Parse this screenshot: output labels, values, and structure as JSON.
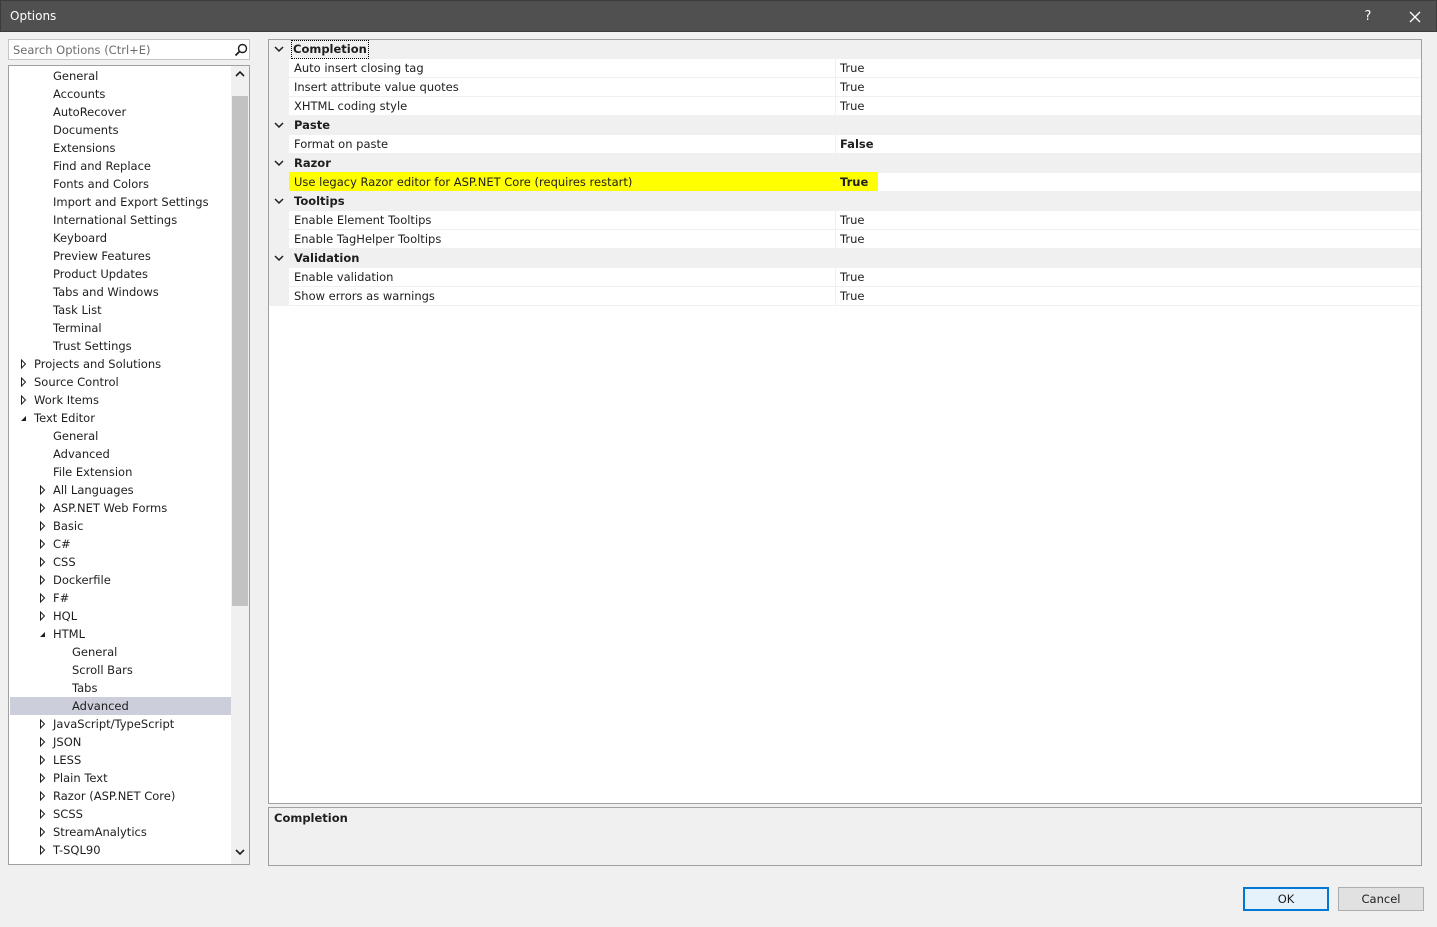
{
  "window": {
    "title": "Options",
    "help_label": "?"
  },
  "search": {
    "placeholder": "Search Options (Ctrl+E)",
    "value": ""
  },
  "tree": {
    "items": [
      {
        "label": "General",
        "level": 2,
        "arrow": "none"
      },
      {
        "label": "Accounts",
        "level": 2,
        "arrow": "none"
      },
      {
        "label": "AutoRecover",
        "level": 2,
        "arrow": "none"
      },
      {
        "label": "Documents",
        "level": 2,
        "arrow": "none"
      },
      {
        "label": "Extensions",
        "level": 2,
        "arrow": "none"
      },
      {
        "label": "Find and Replace",
        "level": 2,
        "arrow": "none"
      },
      {
        "label": "Fonts and Colors",
        "level": 2,
        "arrow": "none"
      },
      {
        "label": "Import and Export Settings",
        "level": 2,
        "arrow": "none"
      },
      {
        "label": "International Settings",
        "level": 2,
        "arrow": "none"
      },
      {
        "label": "Keyboard",
        "level": 2,
        "arrow": "none"
      },
      {
        "label": "Preview Features",
        "level": 2,
        "arrow": "none"
      },
      {
        "label": "Product Updates",
        "level": 2,
        "arrow": "none"
      },
      {
        "label": "Tabs and Windows",
        "level": 2,
        "arrow": "none"
      },
      {
        "label": "Task List",
        "level": 2,
        "arrow": "none"
      },
      {
        "label": "Terminal",
        "level": 2,
        "arrow": "none"
      },
      {
        "label": "Trust Settings",
        "level": 2,
        "arrow": "none"
      },
      {
        "label": "Projects and Solutions",
        "level": 1,
        "arrow": "collapsed"
      },
      {
        "label": "Source Control",
        "level": 1,
        "arrow": "collapsed"
      },
      {
        "label": "Work Items",
        "level": 1,
        "arrow": "collapsed"
      },
      {
        "label": "Text Editor",
        "level": 1,
        "arrow": "expanded"
      },
      {
        "label": "General",
        "level": 2,
        "arrow": "none"
      },
      {
        "label": "Advanced",
        "level": 2,
        "arrow": "none"
      },
      {
        "label": "File Extension",
        "level": 2,
        "arrow": "none"
      },
      {
        "label": "All Languages",
        "level": 2,
        "arrow": "collapsed"
      },
      {
        "label": "ASP.NET Web Forms",
        "level": 2,
        "arrow": "collapsed"
      },
      {
        "label": "Basic",
        "level": 2,
        "arrow": "collapsed"
      },
      {
        "label": "C#",
        "level": 2,
        "arrow": "collapsed"
      },
      {
        "label": "CSS",
        "level": 2,
        "arrow": "collapsed"
      },
      {
        "label": "Dockerfile",
        "level": 2,
        "arrow": "collapsed"
      },
      {
        "label": "F#",
        "level": 2,
        "arrow": "collapsed"
      },
      {
        "label": "HQL",
        "level": 2,
        "arrow": "collapsed"
      },
      {
        "label": "HTML",
        "level": 2,
        "arrow": "expanded"
      },
      {
        "label": "General",
        "level": 3,
        "arrow": "none"
      },
      {
        "label": "Scroll Bars",
        "level": 3,
        "arrow": "none"
      },
      {
        "label": "Tabs",
        "level": 3,
        "arrow": "none"
      },
      {
        "label": "Advanced",
        "level": 3,
        "arrow": "none",
        "selected": true
      },
      {
        "label": "JavaScript/TypeScript",
        "level": 2,
        "arrow": "collapsed"
      },
      {
        "label": "JSON",
        "level": 2,
        "arrow": "collapsed"
      },
      {
        "label": "LESS",
        "level": 2,
        "arrow": "collapsed"
      },
      {
        "label": "Plain Text",
        "level": 2,
        "arrow": "collapsed"
      },
      {
        "label": "Razor (ASP.NET Core)",
        "level": 2,
        "arrow": "collapsed"
      },
      {
        "label": "SCSS",
        "level": 2,
        "arrow": "collapsed"
      },
      {
        "label": "StreamAnalytics",
        "level": 2,
        "arrow": "collapsed"
      },
      {
        "label": "T-SQL90",
        "level": 2,
        "arrow": "collapsed"
      }
    ]
  },
  "grid": {
    "categories": [
      {
        "name": "Completion",
        "focused": true,
        "properties": [
          {
            "name": "Auto insert closing tag",
            "value": "True",
            "bold": false
          },
          {
            "name": "Insert attribute value quotes",
            "value": "True",
            "bold": false
          },
          {
            "name": "XHTML coding style",
            "value": "True",
            "bold": false
          }
        ]
      },
      {
        "name": "Paste",
        "properties": [
          {
            "name": "Format on paste",
            "value": "False",
            "bold": true
          }
        ]
      },
      {
        "name": "Razor",
        "properties": [
          {
            "name": "Use legacy Razor editor for ASP.NET Core (requires restart)",
            "value": "True",
            "bold": true,
            "highlighted": true
          }
        ]
      },
      {
        "name": "Tooltips",
        "properties": [
          {
            "name": "Enable Element Tooltips",
            "value": "True",
            "bold": false
          },
          {
            "name": "Enable TagHelper Tooltips",
            "value": "True",
            "bold": false
          }
        ]
      },
      {
        "name": "Validation",
        "properties": [
          {
            "name": "Enable validation",
            "value": "True",
            "bold": false
          },
          {
            "name": "Show errors as warnings",
            "value": "True",
            "bold": false
          }
        ]
      }
    ]
  },
  "description": {
    "title": "Completion"
  },
  "buttons": {
    "ok_label": "OK",
    "cancel_label": "Cancel"
  },
  "colors": {
    "titlebar": "#505050",
    "highlight": "#ffff00",
    "selection": "#cccedb",
    "default_button_border": "#0078d7"
  }
}
